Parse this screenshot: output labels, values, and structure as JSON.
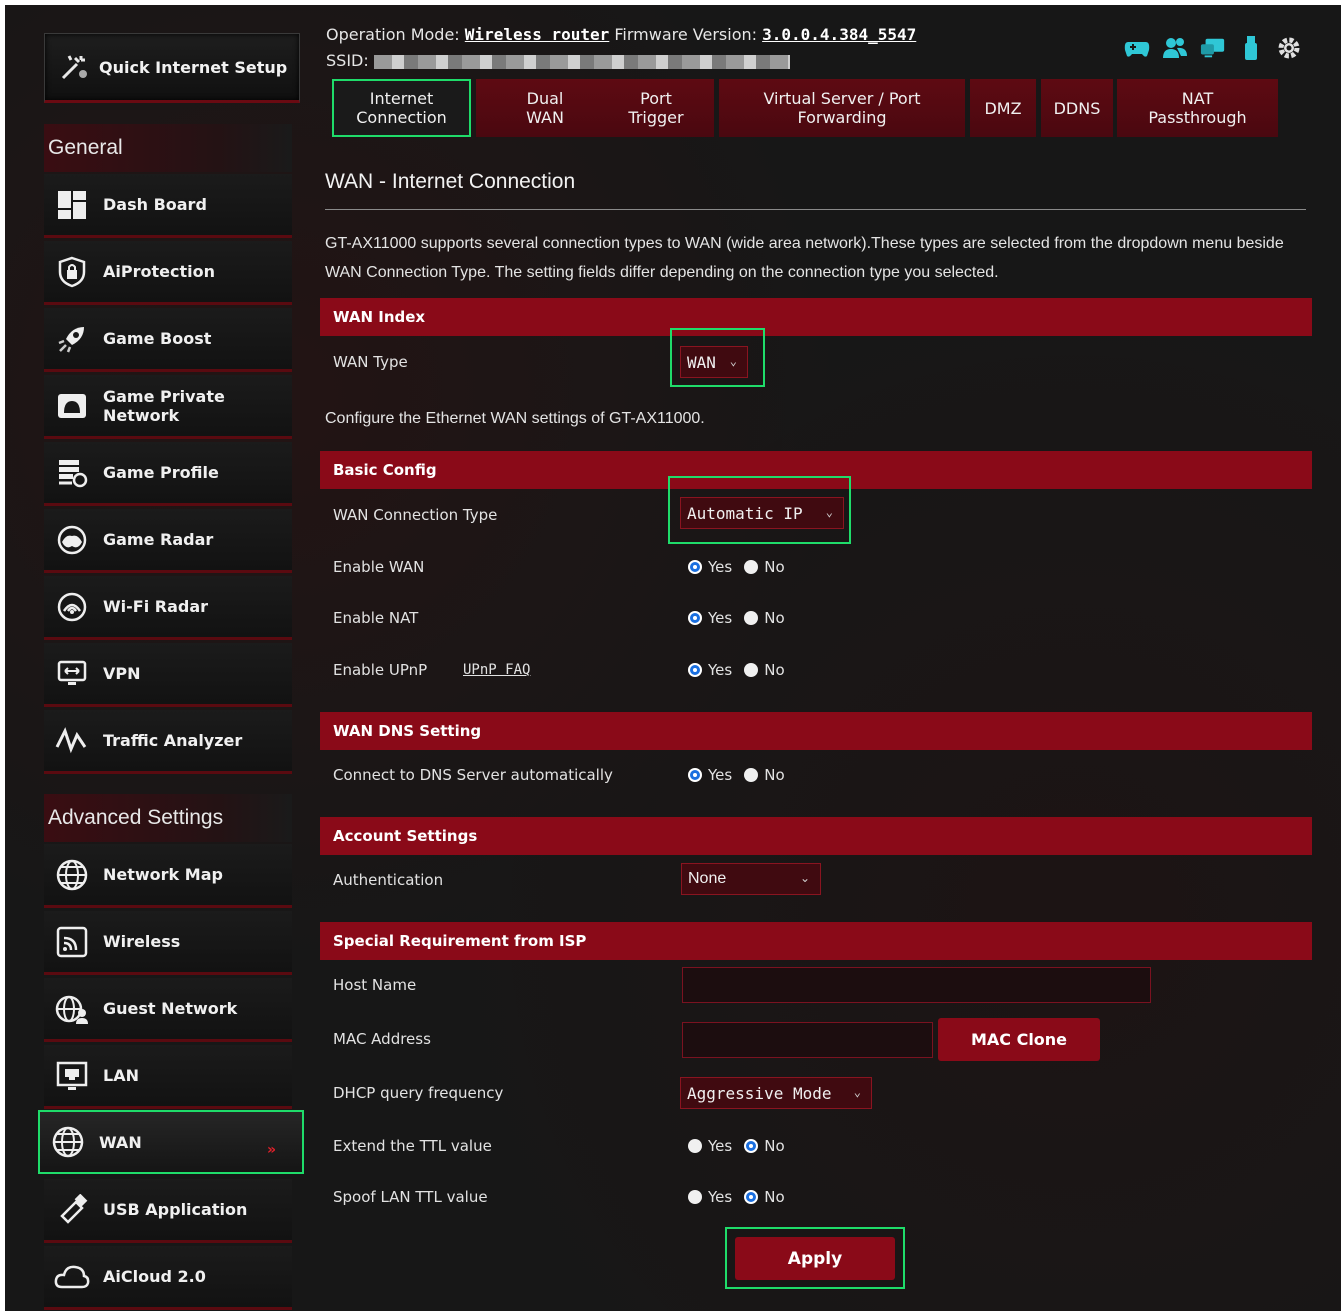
{
  "sidebar": {
    "quick_setup": "Quick Internet Setup",
    "general_title": "General",
    "general_items": [
      {
        "label": "Dash Board",
        "icon": "dashboard-icon"
      },
      {
        "label": "AiProtection",
        "icon": "shield-lock-icon"
      },
      {
        "label": "Game Boost",
        "icon": "rocket-icon"
      },
      {
        "label": "Game Private\nNetwork",
        "icon": "private-network-icon"
      },
      {
        "label": "Game Profile",
        "icon": "game-profile-icon"
      },
      {
        "label": "Game Radar",
        "icon": "radar-icon"
      },
      {
        "label": "Wi-Fi Radar",
        "icon": "wifi-radar-icon"
      },
      {
        "label": "VPN",
        "icon": "vpn-icon"
      },
      {
        "label": "Traffic Analyzer",
        "icon": "traffic-analyzer-icon"
      }
    ],
    "advanced_title": "Advanced Settings",
    "advanced_items": [
      {
        "label": "Network Map",
        "icon": "globe-icon"
      },
      {
        "label": "Wireless",
        "icon": "wireless-icon"
      },
      {
        "label": "Guest Network",
        "icon": "guest-network-icon"
      },
      {
        "label": "LAN",
        "icon": "lan-icon"
      },
      {
        "label": "WAN",
        "icon": "globe-icon",
        "active": true
      },
      {
        "label": "USB Application",
        "icon": "usb-icon"
      },
      {
        "label": "AiCloud 2.0",
        "icon": "cloud-icon"
      }
    ]
  },
  "header": {
    "op_mode_label": "Operation Mode:",
    "op_mode_value": "Wireless router",
    "fw_label": "Firmware Version:",
    "fw_value": "3.0.0.4.384_5547",
    "ssid_label": "SSID:",
    "status_icons": [
      "gamepad-icon",
      "users-icon",
      "devices-icon",
      "usb-stick-icon",
      "gear-icon"
    ]
  },
  "tabs": [
    {
      "label": "Internet\nConnection",
      "active": true
    },
    {
      "label": "Dual\nWAN"
    },
    {
      "label": "Port\nTrigger"
    },
    {
      "label": "Virtual Server / Port\nForwarding"
    },
    {
      "label": "DMZ"
    },
    {
      "label": "DDNS"
    },
    {
      "label": "NAT\nPassthrough"
    }
  ],
  "content": {
    "title": "WAN - Internet Connection",
    "description": "GT-AX11000 supports several connection types to WAN (wide area network).These types are selected from the dropdown menu beside WAN Connection Type. The setting fields differ depending on the connection type you selected.",
    "ethernet_note": "Configure the Ethernet WAN settings of GT-AX11000.",
    "sections": {
      "wan_index": "WAN Index",
      "basic_config": "Basic Config",
      "wan_dns": "WAN DNS Setting",
      "account": "Account Settings",
      "isp": "Special Requirement from ISP"
    },
    "fields": {
      "wan_type_label": "WAN Type",
      "wan_type_value": "WAN",
      "conn_type_label": "WAN Connection Type",
      "conn_type_value": "Automatic IP",
      "enable_wan_label": "Enable WAN",
      "enable_nat_label": "Enable NAT",
      "enable_upnp_label": "Enable UPnP",
      "upnp_faq": "UPnP FAQ",
      "dns_auto_label": "Connect to DNS Server automatically",
      "auth_label": "Authentication",
      "auth_value": "None",
      "host_name_label": "Host Name",
      "host_name_value": "",
      "mac_label": "MAC Address",
      "mac_value": "",
      "dhcp_freq_label": "DHCP query frequency",
      "dhcp_freq_value": "Aggressive Mode",
      "ttl_extend_label": "Extend the TTL value",
      "ttl_spoof_label": "Spoof LAN TTL value"
    },
    "radio": {
      "yes": "Yes",
      "no": "No"
    },
    "radio_states": {
      "enable_wan": "yes",
      "enable_nat": "yes",
      "enable_upnp": "yes",
      "dns_auto": "yes",
      "ttl_extend": "no",
      "ttl_spoof": "no"
    },
    "buttons": {
      "mac_clone": "MAC Clone",
      "apply": "Apply"
    }
  },
  "colors": {
    "accent_red": "#8a0a18",
    "highlight_green": "#1fdc6a",
    "radio_blue": "#1a6fe0",
    "status_icon_cyan": "#2fc7d6"
  }
}
